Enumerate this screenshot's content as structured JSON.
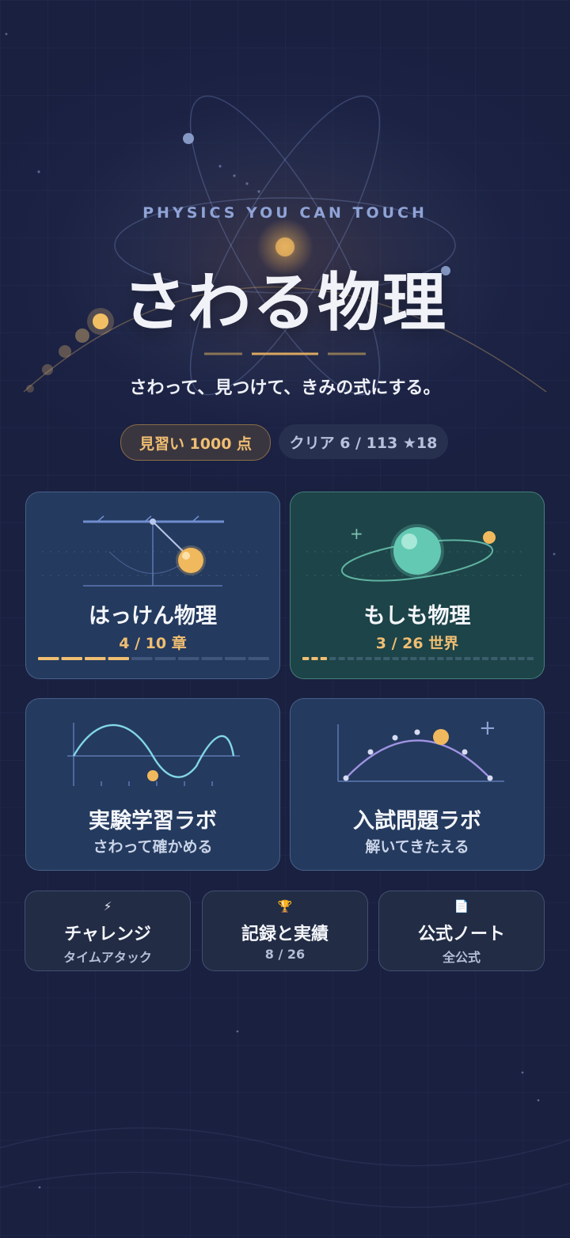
{
  "hero": {
    "subtitle": "PHYSICS YOU CAN TOUCH",
    "title": "さわる物理",
    "tagline": "さわって、見つけて、きみの式にする。"
  },
  "status": {
    "rank": "見習い  1000 点",
    "clear": "クリア 6 / 113  ★18"
  },
  "modes": [
    {
      "title": "はっけん物理",
      "meta": "4 / 10 章",
      "progress": 0.4,
      "segments": 10
    },
    {
      "title": "もしも物理",
      "meta": "3 / 26 世界",
      "progress": 0.115,
      "segments": 26
    },
    {
      "title": "実験学習ラボ",
      "meta": "さわって確かめる"
    },
    {
      "title": "入試問題ラボ",
      "meta": "解いてきたえる"
    }
  ],
  "shortcuts": [
    {
      "icon": "⚡",
      "title": "チャレンジ",
      "meta": "タイムアタック"
    },
    {
      "icon": "🏆",
      "title": "記録と実績",
      "meta": "8 / 26"
    },
    {
      "icon": "📄",
      "title": "公式ノート",
      "meta": "全公式"
    }
  ],
  "colors": {
    "accent_gold": "#f0be72",
    "card_blue": "#243a5e",
    "card_green": "#1d4448",
    "background": "#1a2040"
  }
}
